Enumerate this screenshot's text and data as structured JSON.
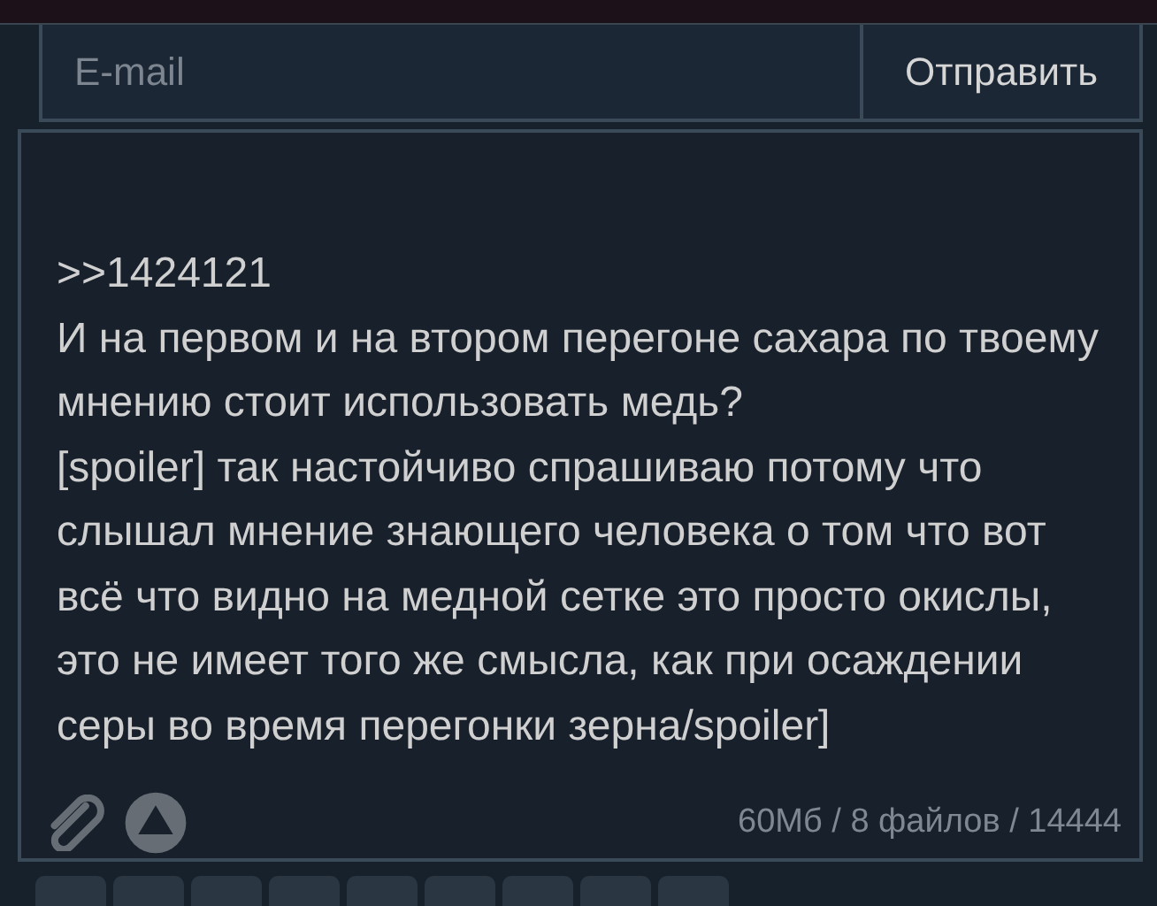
{
  "email": {
    "placeholder": "E-mail"
  },
  "submit_button": {
    "label": "Отправить"
  },
  "message": {
    "value": ">>1424121\nИ на первом и на втором перегоне сахара по твоему мнению стоит использовать медь?\n[spoiler] так настойчиво спрашиваю потому что слышал мнение знающего человека о том что вот всё что видно на медной сетке это просто окислы, это не имеет того же смысла, как при осаждении серы во время перегонки зерна/spoiler]"
  },
  "counter": "60Мб / 8 файлов / 14444"
}
